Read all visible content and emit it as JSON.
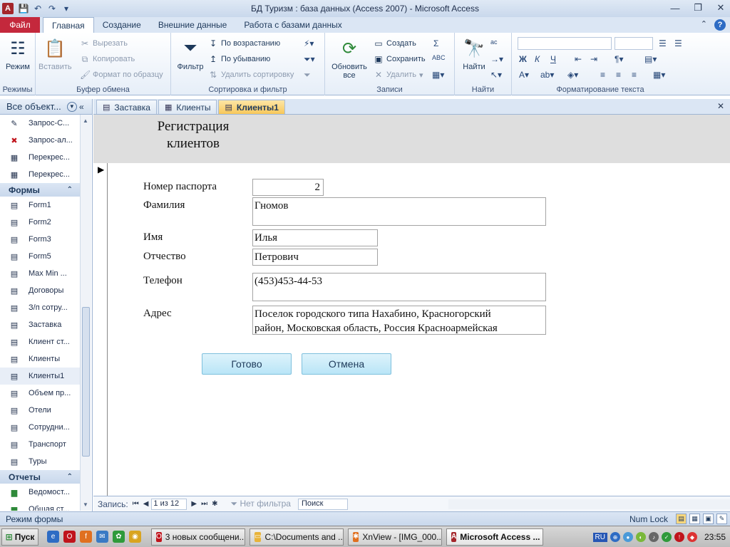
{
  "window": {
    "title": "БД Туризм : база данных (Access 2007)  -  Microsoft Access",
    "app_icon": "A"
  },
  "ribbon_tabs": [
    "Файл",
    "Главная",
    "Создание",
    "Внешние данные",
    "Работа с базами данных"
  ],
  "ribbon": {
    "views": {
      "label": "Режим",
      "group": "Режимы"
    },
    "clipboard": {
      "paste": "Вставить",
      "cut": "Вырезать",
      "copy": "Копировать",
      "format_painter": "Формат по образцу",
      "group": "Буфер обмена"
    },
    "sort_filter": {
      "filter": "Фильтр",
      "ascending": "По возрастанию",
      "descending": "По убыванию",
      "remove_sort": "Удалить сортировку",
      "group": "Сортировка и фильтр"
    },
    "records": {
      "refresh": "Обновить",
      "refresh_sub": "все",
      "new": "Создать",
      "save": "Сохранить",
      "delete": "Удалить",
      "group": "Записи"
    },
    "find": {
      "find": "Найти",
      "group": "Найти"
    },
    "text_format": {
      "bold": "Ж",
      "italic": "К",
      "underline": "Ч",
      "font_color": "А",
      "group": "Форматирование текста"
    }
  },
  "nav_pane": {
    "header": "Все объект...",
    "top_items": [
      {
        "label": "Запрос-С...",
        "icon": "update-query-icon"
      },
      {
        "label": "Запрос-ал...",
        "icon": "delete-query-icon"
      },
      {
        "label": "Перекрес...",
        "icon": "crosstab-query-icon"
      },
      {
        "label": "Перекрес...",
        "icon": "crosstab-query-icon"
      }
    ],
    "forms_group": "Формы",
    "forms": [
      "Form1",
      "Form2",
      "Form3",
      "Form5",
      "Max Min ...",
      "Договоры",
      "З/п сотру...",
      "Заставка",
      "Клиент ст...",
      "Клиенты",
      "Клиенты1",
      "Объем пр...",
      "Отели",
      "Сотрудни...",
      "Транспорт",
      "Туры"
    ],
    "selected_form": "Клиенты1",
    "reports_group": "Отчеты",
    "reports": [
      "Ведомост...",
      "Общая ст..."
    ]
  },
  "doc_tabs": [
    "Заставка",
    "Клиенты",
    "Клиенты1"
  ],
  "active_doc_tab": "Клиенты1",
  "form": {
    "title": "Регистрация клиентов",
    "fields": {
      "passport": {
        "label": "Номер паспорта",
        "value": "2"
      },
      "surname": {
        "label": "Фамилия",
        "value": "Гномов"
      },
      "name": {
        "label": "Имя",
        "value": "Илья"
      },
      "patronymic": {
        "label": "Отчество",
        "value": "Петрович"
      },
      "phone": {
        "label": "Телефон",
        "value": "(453)453-44-53"
      },
      "address": {
        "label": "Адрес",
        "value": "Поселок городского типа Нахабино, Красногорский район, Московская область, Россия Красноармейская"
      }
    },
    "buttons": {
      "ok": "Готово",
      "cancel": "Отмена"
    }
  },
  "record_nav": {
    "label": "Запись:",
    "position": "1 из 12",
    "filter": "Нет фильтра",
    "search": "Поиск"
  },
  "status": {
    "left": "Режим формы",
    "right": "Num Lock"
  },
  "taskbar": {
    "start": "Пуск",
    "tasks": [
      {
        "label": "3 новых сообщени...",
        "color": "#c0141c"
      },
      {
        "label": "C:\\Documents and ...",
        "color": "#e8b33a"
      },
      {
        "label": "XnView - [IMG_000...",
        "color": "#e07020"
      },
      {
        "label": "Microsoft Access ...",
        "color": "#a4262c"
      }
    ],
    "lang": "RU",
    "clock": "23:55"
  }
}
